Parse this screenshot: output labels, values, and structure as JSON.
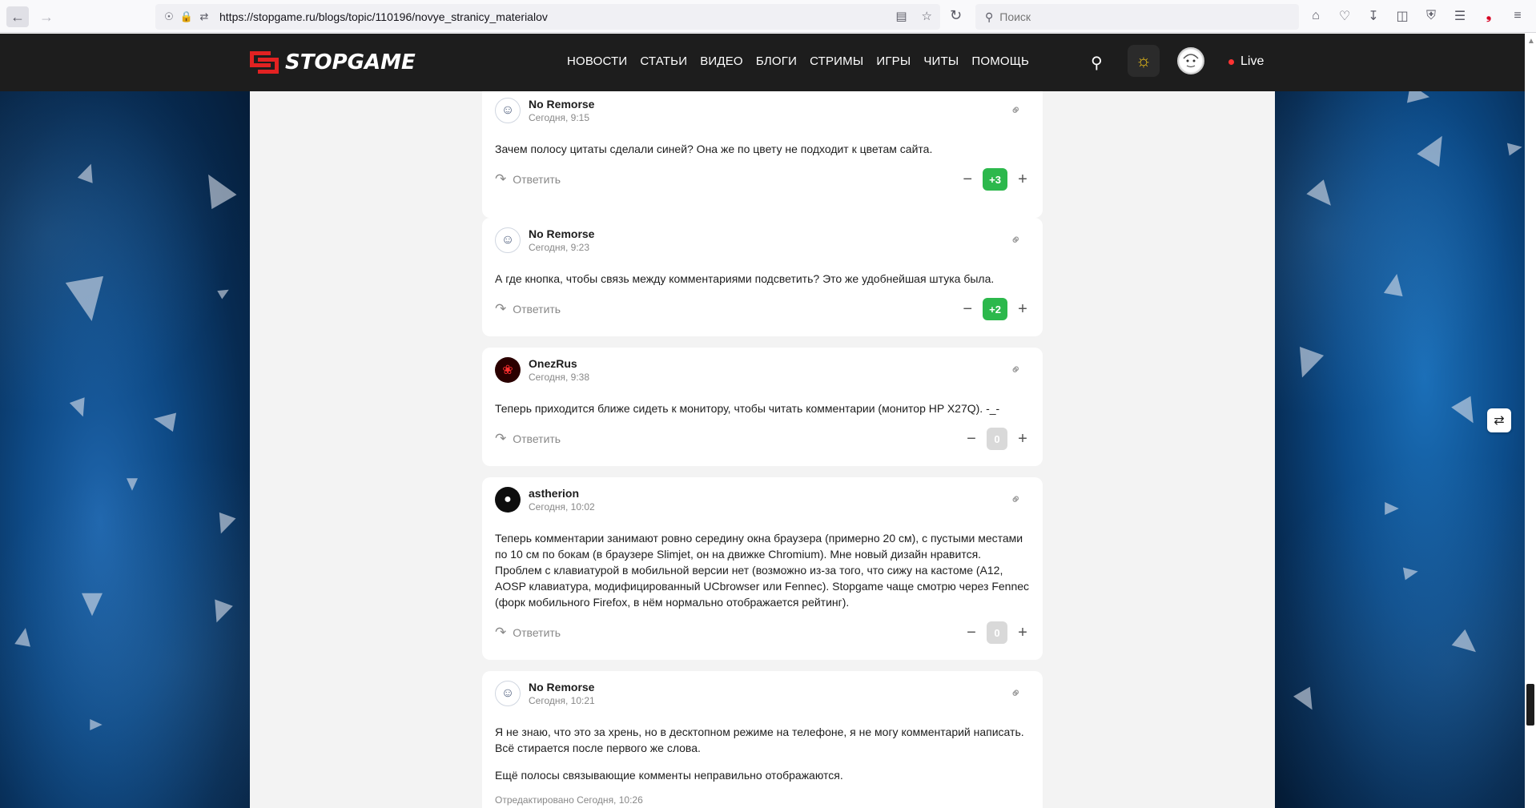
{
  "browser": {
    "url": "https://stopgame.ru/blogs/topic/110196/novye_stranicy_materialov",
    "search_placeholder": "Поиск"
  },
  "header": {
    "logo_text": "STOPGAME",
    "nav": [
      "НОВОСТИ",
      "СТАТЬИ",
      "ВИДЕО",
      "БЛОГИ",
      "СТРИМЫ",
      "ИГРЫ",
      "ЧИТЫ",
      "ПОМОЩЬ"
    ],
    "live_label": "Live"
  },
  "colors": {
    "header_bg": "#1d1d1d",
    "accent_red": "#e22222",
    "vote_positive": "#2cb84c",
    "vote_zero": "#d9d9d9",
    "page_bg": "#f3f3f3"
  },
  "comments": [
    {
      "author": "No Remorse",
      "time": "Сегодня, 9:15",
      "avatar": "sketch-avatar",
      "paragraphs": [
        "Зачем полосу цитаты сделали синей? Она же по цвету не подходит к цветам сайта."
      ],
      "reply_label": "Ответить",
      "score": "+3",
      "score_type": "pos"
    },
    {
      "author": "No Remorse",
      "time": "Сегодня, 9:23",
      "avatar": "sketch-avatar",
      "paragraphs": [
        "А где кнопка, чтобы связь между комментариями подсветить? Это же удобнейшая штука была."
      ],
      "reply_label": "Ответить",
      "score": "+2",
      "score_type": "pos"
    },
    {
      "author": "OnezRus",
      "time": "Сегодня, 9:38",
      "avatar": "red-avatar",
      "paragraphs": [
        "Теперь приходится ближе сидеть к монитору, чтобы читать комментарии (монитор HP X27Q). -_-"
      ],
      "reply_label": "Ответить",
      "score": "0",
      "score_type": "zero"
    },
    {
      "author": "astherion",
      "time": "Сегодня, 10:02",
      "avatar": "dark-avatar",
      "paragraphs": [
        "Теперь комментарии занимают ровно середину окна браузера (примерно 20 см), с пустыми местами по 10 см по бокам (в браузере Slimjet, он на движке Chromium). Мне новый дизайн нравится. Проблем с клавиатурой в мобильной версии нет (возможно из-за того, что сижу на кастоме (A12, AOSP клавиатура, модифицированный UCbrowser или Fennec). Stopgame чаще смотрю через Fennec (форк мобильного Firefox, в нём нормально отображается рейтинг)."
      ],
      "reply_label": "Ответить",
      "score": "0",
      "score_type": "zero"
    },
    {
      "author": "No Remorse",
      "time": "Сегодня, 10:21",
      "avatar": "sketch-avatar",
      "paragraphs": [
        "Я не знаю, что это за хрень, но в десктопном режиме на телефоне, я не могу комментарий написать. Всё стирается после первого же слова.",
        "Ещё полосы связывающие комменты неправильно отображаются."
      ],
      "edited": "Отредактировано Сегодня, 10:26"
    }
  ]
}
